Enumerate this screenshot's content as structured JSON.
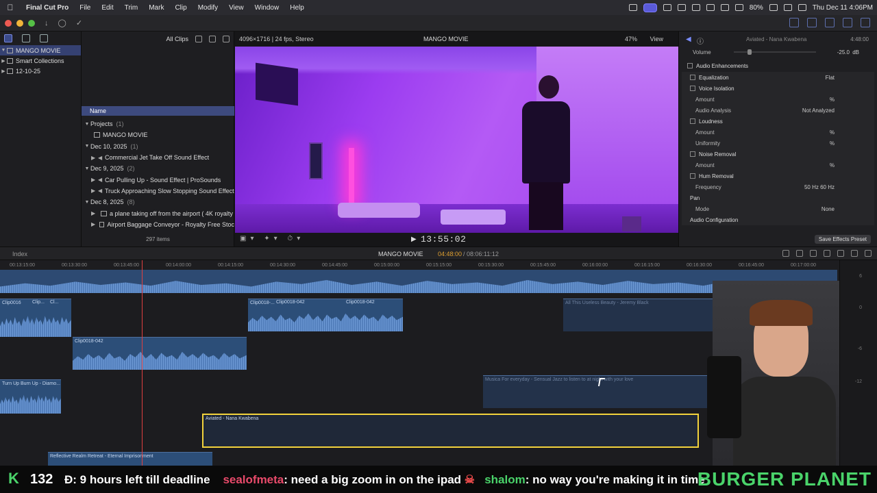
{
  "menubar": {
    "app": "Final Cut Pro",
    "items": [
      "File",
      "Edit",
      "Trim",
      "Mark",
      "Clip",
      "Modify",
      "View",
      "Window",
      "Help"
    ],
    "battery": "80%",
    "clock": "Thu Dec 11  4:06PM"
  },
  "library": {
    "items": [
      {
        "label": "MANGO MOVIE"
      },
      {
        "label": "Smart Collections"
      },
      {
        "label": "12-10-25"
      }
    ]
  },
  "browser": {
    "filter": "All Clips",
    "column": "Name",
    "rows": [
      {
        "type": "group",
        "label": "Projects",
        "count": "(1)"
      },
      {
        "type": "project",
        "label": "MANGO MOVIE"
      },
      {
        "type": "group",
        "label": "Dec 10, 2025",
        "count": "(1)"
      },
      {
        "type": "audio",
        "label": "Commercial Jet Take Off Sound Effect"
      },
      {
        "type": "group",
        "label": "Dec 9, 2025",
        "count": "(2)"
      },
      {
        "type": "audio",
        "label": "Car Pulling Up - Sound Effect  |  ProSounds"
      },
      {
        "type": "audio",
        "label": "Truck Approaching Slow Stopping Sound Effect"
      },
      {
        "type": "group",
        "label": "Dec 8, 2025",
        "count": "(8)"
      },
      {
        "type": "clip",
        "label": "a plane taking off from the airport ( 4K royalty"
      },
      {
        "type": "clip",
        "label": "Airport Baggage Conveyor - Royalty Free Stoc"
      }
    ],
    "footer": "297 items"
  },
  "viewer": {
    "info": "4096×1716 | 24 fps, Stereo",
    "title": "MANGO MOVIE",
    "zoom": "47%",
    "view": "View",
    "timecode": "13:55:02"
  },
  "inspector": {
    "clip_name": "Aviated - Nana Kwabena",
    "duration": "4:48:00",
    "volume_label": "Volume",
    "volume_value": "-25.0",
    "volume_unit": "dB",
    "enhancements": "Audio Enhancements",
    "rows": [
      {
        "kind": "sec",
        "label": "Equalization",
        "val": "Flat"
      },
      {
        "kind": "sec",
        "label": "Voice Isolation",
        "val": ""
      },
      {
        "kind": "row",
        "label": "Amount",
        "val": "%"
      },
      {
        "kind": "row",
        "label": "Audio Analysis",
        "val": "Not Analyzed"
      },
      {
        "kind": "sec",
        "label": "Loudness",
        "val": ""
      },
      {
        "kind": "row",
        "label": "Amount",
        "val": "%"
      },
      {
        "kind": "row",
        "label": "Uniformity",
        "val": "%"
      },
      {
        "kind": "sec",
        "label": "Noise Removal",
        "val": ""
      },
      {
        "kind": "row",
        "label": "Amount",
        "val": "%"
      },
      {
        "kind": "sec",
        "label": "Hum Removal",
        "val": ""
      },
      {
        "kind": "row",
        "label": "Frequency",
        "val": "50 Hz    60 Hz"
      },
      {
        "kind": "sec2",
        "label": "Pan",
        "val": ""
      },
      {
        "kind": "row",
        "label": "Mode",
        "val": "None"
      },
      {
        "kind": "sec2",
        "label": "Audio Configuration",
        "val": ""
      }
    ],
    "save_button": "Save Effects Preset"
  },
  "timeline": {
    "index": "Index",
    "project": "MANGO MOVIE",
    "position": "04:48:00",
    "total": "/ 08:06:11:12",
    "ruler": [
      "00:13:15:00",
      "00:13:30:00",
      "00:13:45:00",
      "00:14:00:00",
      "00:14:15:00",
      "00:14:30:00",
      "00:14:45:00",
      "00:15:00:00",
      "00:15:15:00",
      "00:15:30:00",
      "00:15:45:00",
      "00:16:00:00",
      "00:16:15:00",
      "00:16:30:00",
      "00:16:45:00",
      "00:17:00:00"
    ],
    "clips": [
      {
        "name": "Clip0016"
      },
      {
        "name": "Clip..."
      },
      {
        "name": "Cl..."
      },
      {
        "name": "Clip0018-..."
      },
      {
        "name": "Clip0018-042"
      },
      {
        "name": "Clip0018-042"
      },
      {
        "name": "All This Useless Beauty - Jeremy Black"
      },
      {
        "name": "Clip0018-042"
      },
      {
        "name": "Turn Up Burn Up - Diamo..."
      },
      {
        "name": "Musica For everyday - Sensual Jazz to listen to at night with your love"
      },
      {
        "name": "Aviated - Nana Kwabena"
      },
      {
        "name": "Reflective Realm Retreat - Eternal Imprisonment"
      }
    ],
    "meter": [
      "6",
      "0",
      "-6",
      "-12"
    ]
  },
  "chat": {
    "count": "132",
    "messages": [
      {
        "user": "",
        "text": "Đ: 9 hours left till deadline"
      },
      {
        "user": "sealofmeta",
        "text": ": need a big zoom in on the ipad"
      },
      {
        "user": "shalom",
        "text": ": no way you're making it in time"
      }
    ],
    "brand": "BURGER PLANET"
  }
}
